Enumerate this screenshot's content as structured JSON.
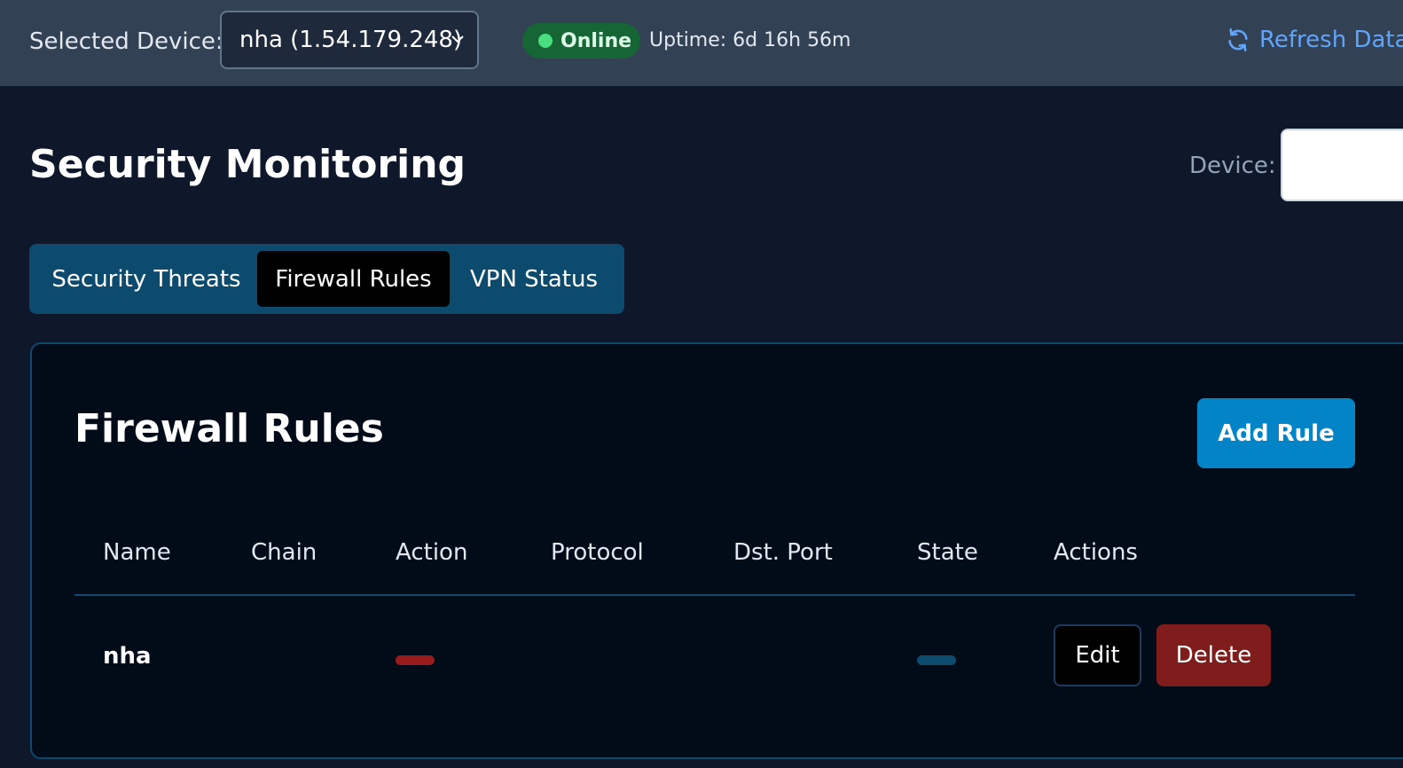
{
  "topbar": {
    "selected_device_label": "Selected Device:",
    "selected_device_value": "nha (1.54.179.248)",
    "status_text": "Online",
    "status_color": "#4ade80",
    "uptime": "Uptime: 6d 16h 56m",
    "refresh_label": "Refresh Data"
  },
  "header": {
    "title": "Security Monitoring",
    "device_filter_label": "Device:",
    "device_filter_value": ""
  },
  "tabs": [
    {
      "label": "Security Threats",
      "active": false
    },
    {
      "label": "Firewall Rules",
      "active": true
    },
    {
      "label": "VPN Status",
      "active": false
    }
  ],
  "firewall": {
    "title": "Firewall Rules",
    "add_label": "Add Rule",
    "columns": [
      "Name",
      "Chain",
      "Action",
      "Protocol",
      "Dst. Port",
      "State",
      "Actions"
    ],
    "rows": [
      {
        "name": "nha",
        "chain": "",
        "action": "",
        "protocol": "",
        "dst_port": "",
        "state": "",
        "edit_label": "Edit",
        "delete_label": "Delete"
      }
    ]
  },
  "colors": {
    "accent": "#0284c7",
    "danger": "#7f1d1d",
    "link": "#60a5fa"
  },
  "icons": {
    "refresh": "refresh-icon",
    "select": "chevron-down-icon",
    "status": "status-dot-icon"
  }
}
